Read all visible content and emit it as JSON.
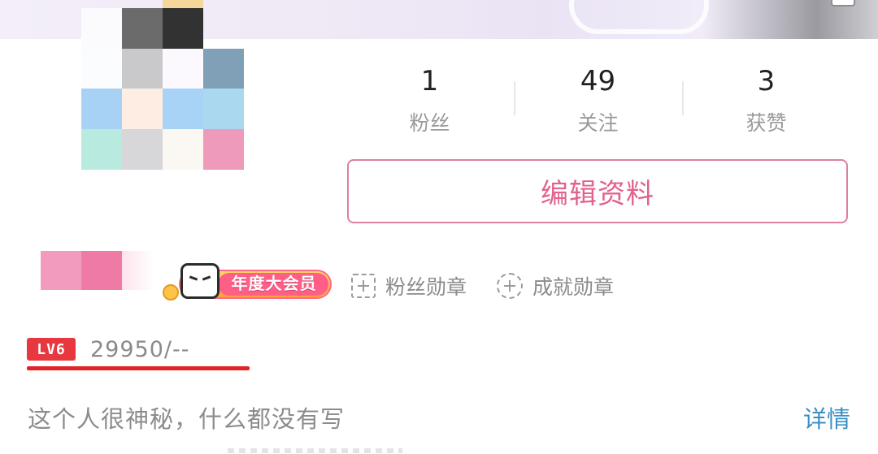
{
  "stats": [
    {
      "value": "1",
      "label": "粉丝"
    },
    {
      "value": "49",
      "label": "关注"
    },
    {
      "value": "3",
      "label": "获赞"
    }
  ],
  "edit_profile_label": "编辑资料",
  "vip_badge_label": "年度大会员",
  "badges": [
    {
      "label": "粉丝勋章",
      "icon": "fan-medal-add-icon"
    },
    {
      "label": "成就勋章",
      "icon": "achievement-medal-add-icon"
    }
  ],
  "level": {
    "badge": "LV6",
    "exp": "29950/--"
  },
  "bio": "这个人很神秘，什么都没有写",
  "details_link": "详情",
  "colors": {
    "accent_pink": "#e0628f",
    "level_red": "#e8383f",
    "link_blue": "#3a8fc7",
    "text_gray": "#8c8c8c"
  }
}
